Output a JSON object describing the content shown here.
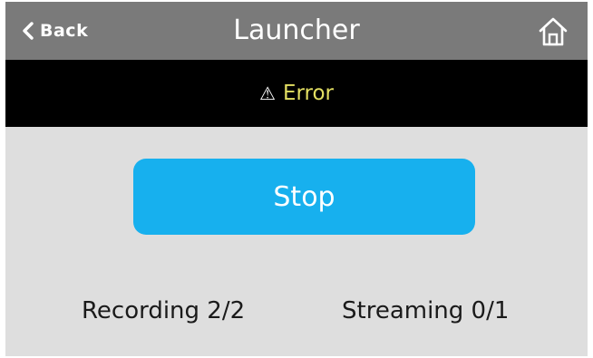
{
  "header": {
    "back_label": "Back",
    "title": "Launcher",
    "home_icon": "home-icon",
    "background": "#7a7a7a"
  },
  "status": {
    "icon": "⚠",
    "text": "Error",
    "text_color": "#e3df62",
    "background": "#000000"
  },
  "main": {
    "stop_label": "Stop",
    "button_color": "#17b0ee"
  },
  "counters": {
    "recording": "Recording 2/2",
    "streaming": "Streaming 0/1"
  }
}
